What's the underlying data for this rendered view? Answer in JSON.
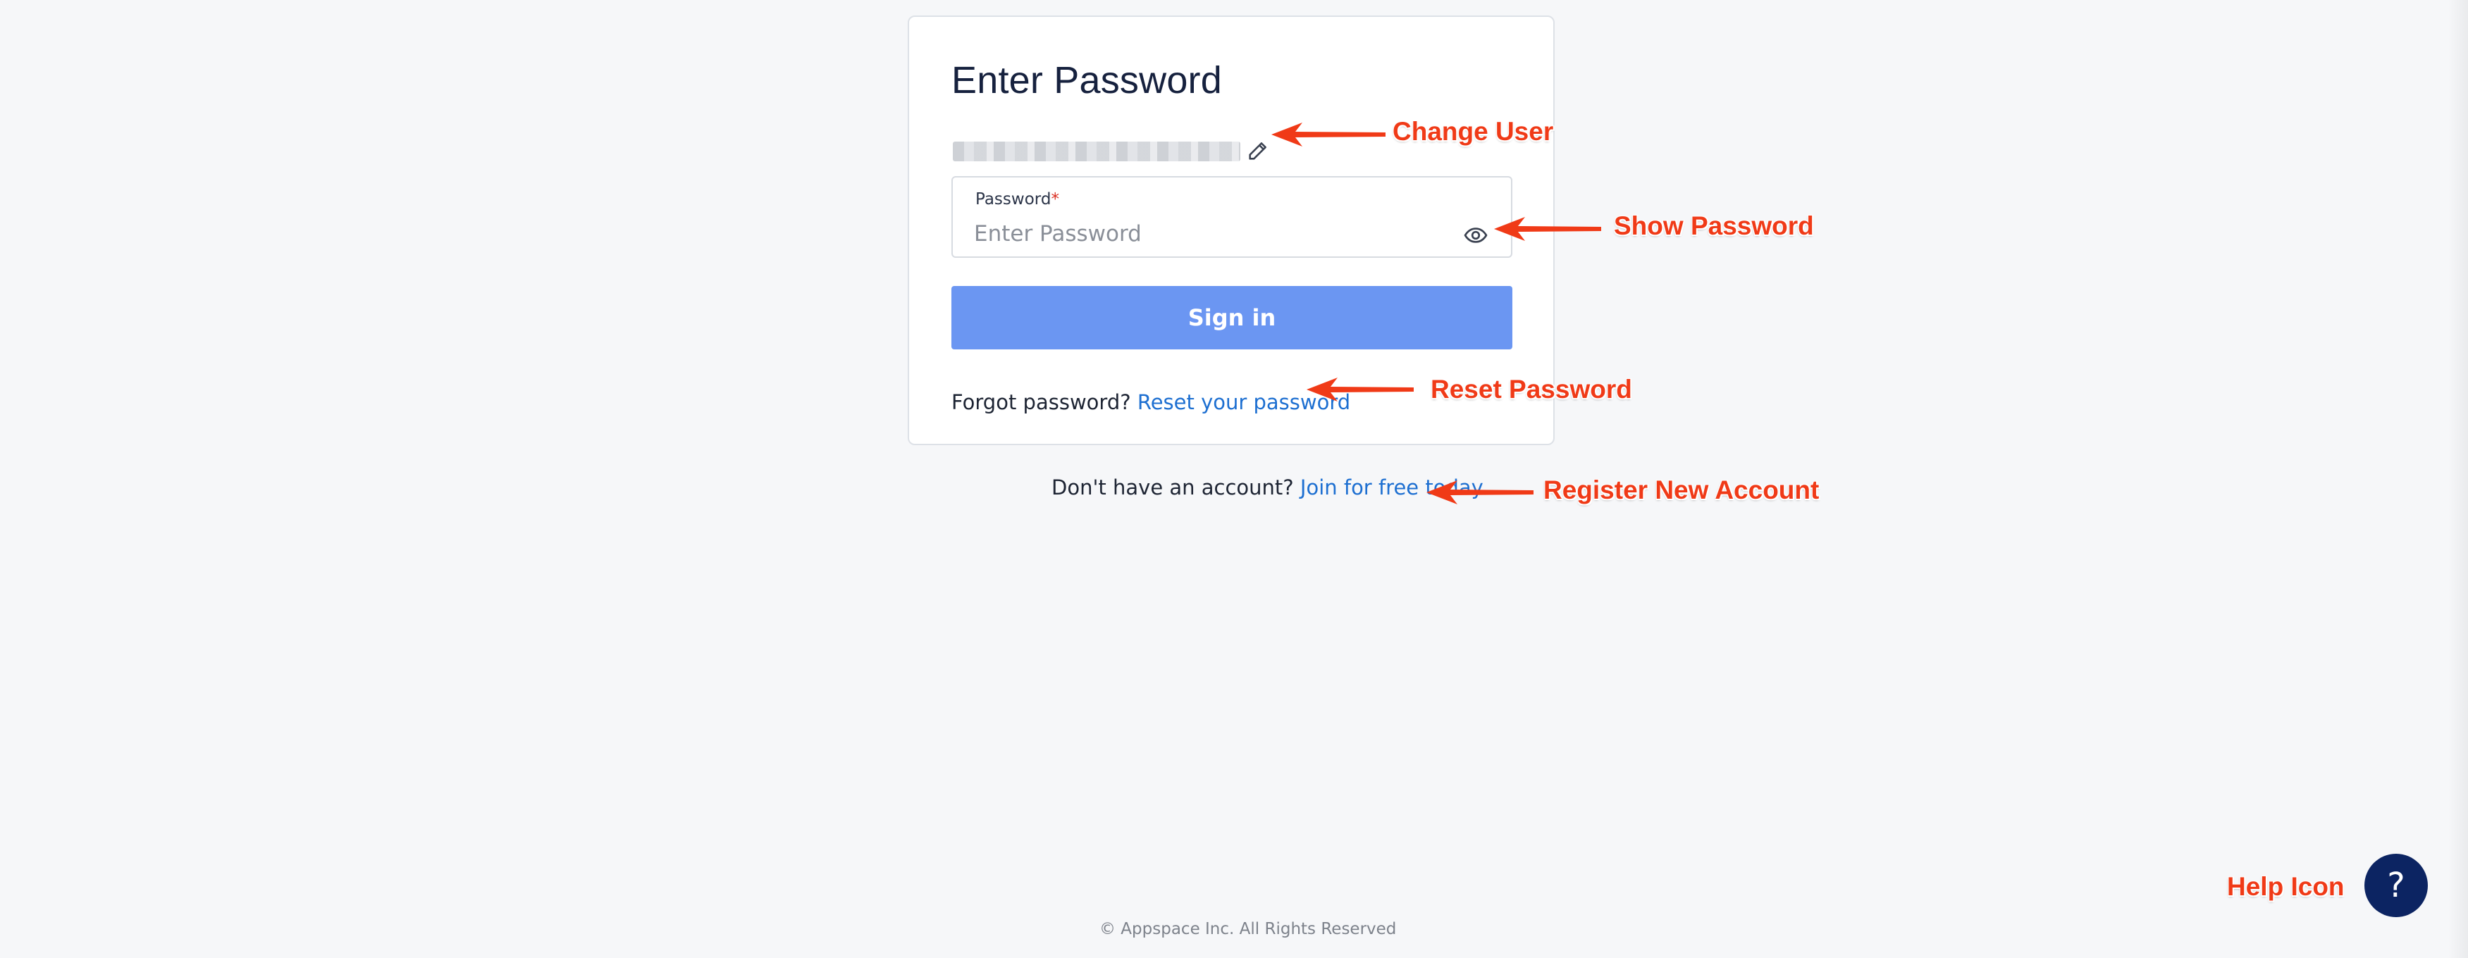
{
  "login": {
    "title": "Enter Password",
    "password_label": "Password",
    "required_mark": "*",
    "password_placeholder": "Enter Password",
    "signin_label": "Sign in",
    "forgot_prefix": "Forgot password?",
    "reset_link": "Reset your password"
  },
  "footer": {
    "register_prefix": "Don't have an account?",
    "register_link": "Join for free today",
    "copyright": "© Appspace Inc. All Rights Reserved"
  },
  "help": {
    "glyph": "?"
  },
  "annotations": {
    "change_user": "Change User",
    "show_password": "Show Password",
    "reset_password": "Reset Password",
    "register_new_account": "Register New Account",
    "help_icon": "Help Icon"
  },
  "icons": [
    "pencil-icon",
    "eye-icon",
    "help-icon"
  ],
  "colors": {
    "background": "#f6f7f9",
    "primary_button": "#6b96f2",
    "link": "#1d6fd1",
    "help_button": "#0c2462",
    "annotation": "#f03a17",
    "required": "#d92d20"
  }
}
